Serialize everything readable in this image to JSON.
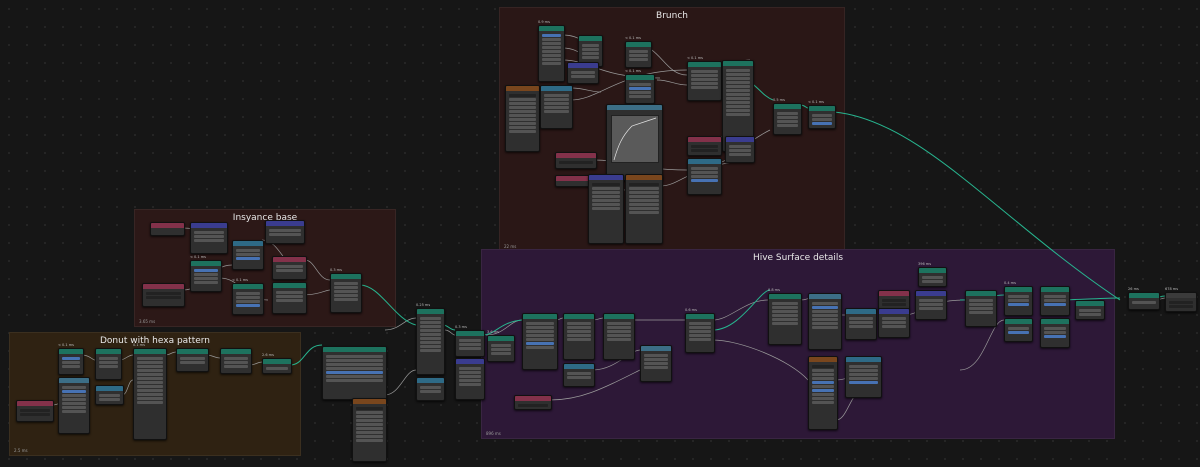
{
  "frames": [
    {
      "id": "brunch",
      "label": "Brunch",
      "time": "22 ms"
    },
    {
      "id": "insyance",
      "label": "Insyance base",
      "time": "3.65 ms"
    },
    {
      "id": "donut",
      "label": "Donut with hexa pattern",
      "time": "2.5 ms"
    },
    {
      "id": "hive",
      "label": "Hive Surface details",
      "time": "896 ms"
    }
  ],
  "node_timings": {
    "brunch_a": "0.9 ms",
    "brunch_b": "< 0.1 ms",
    "brunch_c": "< 0.1 ms",
    "brunch_d": "< 0.1 ms",
    "brunch_e": "0.5 ms",
    "brunch_f": "< 0.1 ms",
    "insy_a": "< 0.1 ms",
    "insy_b": "< 0.1 ms",
    "insy_c": "0.3 ms",
    "donut_a": "< 0.1 ms",
    "donut_b": "0.1 ms",
    "donut_c": "2.6 ms",
    "mid_a": "0.25 ms",
    "mid_b": "0.3 ms",
    "mid_c": "3.6 ms",
    "hive_a": "0.6 ms",
    "hive_b": "0.8 ms",
    "hive_c": "396 ms",
    "hive_d": "0.4 ms",
    "out_a": "26 ms",
    "out_b": "678 ms"
  },
  "colors": {
    "brunch_frame": "#2a1716",
    "insyance_frame": "#2c1817",
    "donut_frame": "#2f2212",
    "hive_frame": "#2d1837",
    "link_geometry": "#27b58f",
    "link_default": "#9a9a9a",
    "link_float": "#a1a1a1"
  }
}
